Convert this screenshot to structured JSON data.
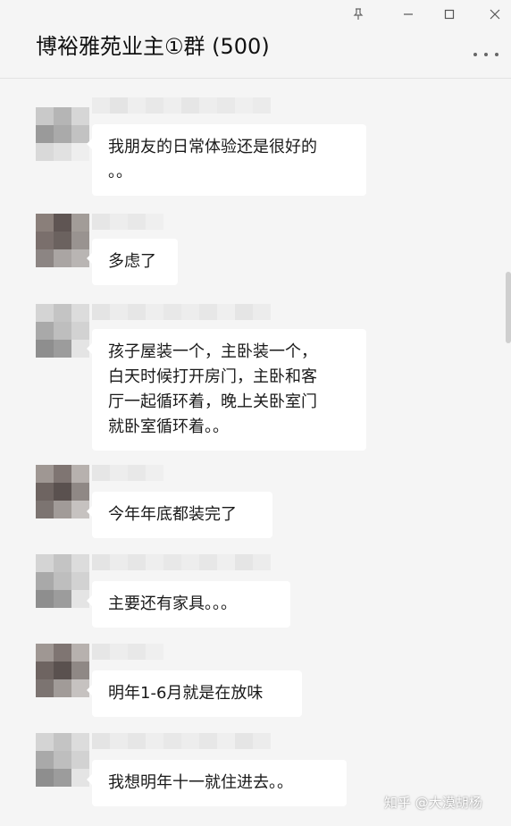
{
  "window": {
    "title": "博裕雅苑业主①群 (500)",
    "pin_icon": "pin-icon",
    "minimize_icon": "minimize-icon",
    "maximize_icon": "maximize-icon",
    "close_icon": "close-icon",
    "more_icon": "more-options-icon"
  },
  "messages": [
    {
      "text": "我朋友的日常体验还是很好的\n。。"
    },
    {
      "text": "多虑了"
    },
    {
      "text": "孩子屋装一个，主卧装一个，\n白天时候打开房门，主卧和客\n厅一起循环着，晚上关卧室门\n就卧室循环着。。"
    },
    {
      "text": "今年年底都装完了"
    },
    {
      "text": "主要还有家具。。。"
    },
    {
      "text": "明年1-6月就是在放味"
    },
    {
      "text": "我想明年十一就住进去。。"
    }
  ],
  "watermark": {
    "text": "知乎 @大漠胡杨"
  },
  "colors": {
    "background": "#f5f5f5",
    "bubble": "#ffffff",
    "text": "#1a1a1a"
  }
}
